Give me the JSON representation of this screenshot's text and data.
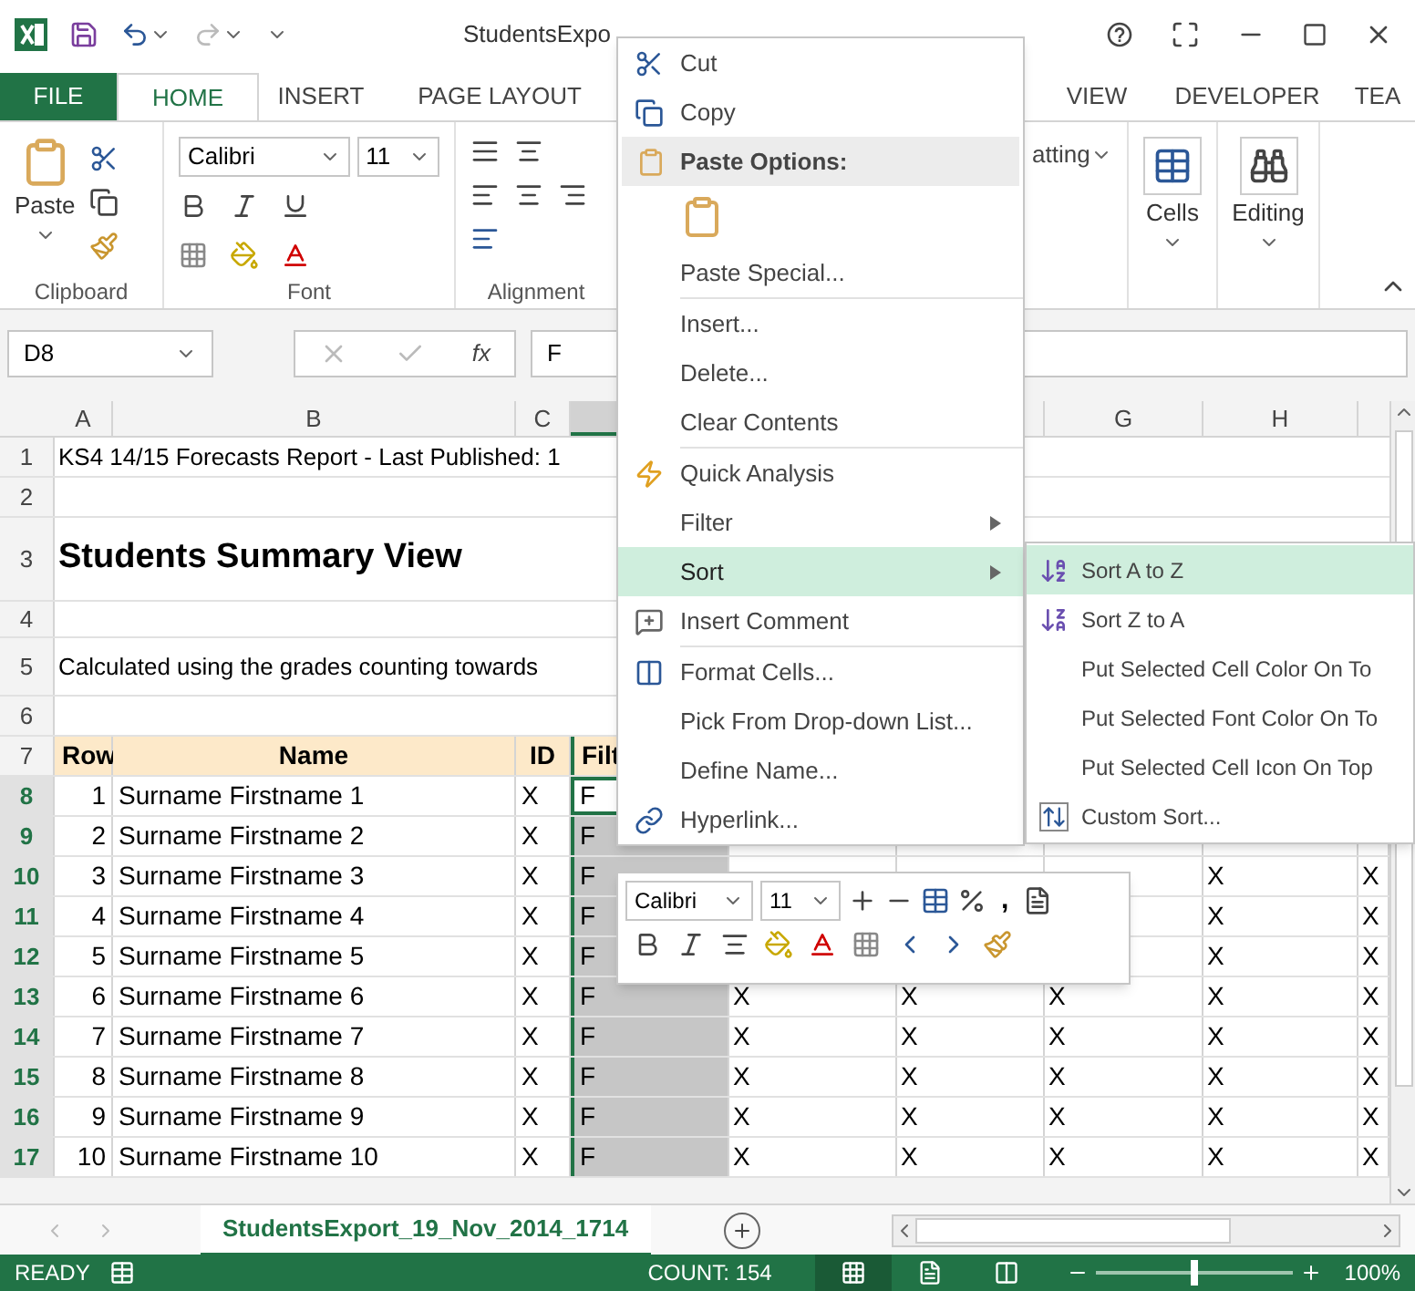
{
  "window": {
    "title": "StudentsExpo"
  },
  "ribbon": {
    "tabs": [
      {
        "label": "FILE",
        "kind": "file",
        "selected": false
      },
      {
        "label": "HOME",
        "kind": "tab",
        "selected": true
      },
      {
        "label": "INSERT",
        "kind": "tab",
        "selected": false
      },
      {
        "label": "PAGE LAYOUT",
        "kind": "tab",
        "selected": false
      },
      {
        "label": "VIEW",
        "kind": "tab",
        "selected": false
      },
      {
        "label": "DEVELOPER",
        "kind": "tab",
        "selected": false
      },
      {
        "label": "TEA",
        "kind": "tab",
        "selected": false
      }
    ],
    "clipboard": {
      "paste": "Paste",
      "label": "Clipboard"
    },
    "font": {
      "name": "Calibri",
      "size": "11",
      "label": "Font"
    },
    "alignment": {
      "label": "Alignment"
    },
    "styles": {
      "label": "atting"
    },
    "cells": {
      "label": "Cells"
    },
    "editing": {
      "label": "Editing"
    }
  },
  "formula_bar": {
    "name_box": "D8",
    "fx": "fx",
    "value": "F"
  },
  "columns_left": [
    {
      "label": "A",
      "selected": false
    },
    {
      "label": "B",
      "selected": false
    },
    {
      "label": "C",
      "selected": false
    }
  ],
  "selected_column": {
    "selected": true
  },
  "columns_right": [
    {
      "label": "G",
      "selected": false
    },
    {
      "label": "H",
      "selected": false
    }
  ],
  "rows": [
    {
      "header": "1",
      "kind": "text",
      "text": "KS4 14/15 Forecasts Report - Last Published: 1",
      "selected": false
    },
    {
      "header": "2",
      "kind": "blank",
      "selected": false
    },
    {
      "header": "3",
      "kind": "heading",
      "text": "Students Summary View",
      "selected": false
    },
    {
      "header": "4",
      "kind": "blank",
      "selected": false
    },
    {
      "header": "5",
      "kind": "text",
      "text": "Calculated using the grades counting towards",
      "selected": false
    },
    {
      "header": "6",
      "kind": "blank",
      "selected": false
    },
    {
      "header": "7",
      "kind": "columns",
      "cells": [
        "Row",
        "Name",
        "ID",
        "Filt"
      ],
      "selected": false
    },
    {
      "header": "8",
      "kind": "data",
      "selected": true,
      "active": true,
      "cells": [
        "1",
        "Surname Firstname 1",
        "X",
        "F"
      ]
    },
    {
      "header": "9",
      "kind": "data",
      "selected": true,
      "active": false,
      "cells": [
        "2",
        "Surname Firstname 2",
        "X",
        "F"
      ]
    },
    {
      "header": "10",
      "kind": "data",
      "selected": true,
      "active": false,
      "cells": [
        "3",
        "Surname Firstname 3",
        "X",
        "F"
      ],
      "marks_right": [
        "X",
        "X"
      ]
    },
    {
      "header": "11",
      "kind": "data",
      "selected": true,
      "active": false,
      "cells": [
        "4",
        "Surname Firstname 4",
        "X",
        "F"
      ],
      "marks_right": [
        "X",
        "X"
      ]
    },
    {
      "header": "12",
      "kind": "data",
      "selected": true,
      "active": false,
      "cells": [
        "5",
        "Surname Firstname 5",
        "X",
        "F"
      ],
      "marks_right": [
        "X",
        "X"
      ]
    },
    {
      "header": "13",
      "kind": "data",
      "selected": true,
      "active": false,
      "cells": [
        "6",
        "Surname Firstname 6",
        "X",
        "F"
      ],
      "marks_left": [
        "X",
        "X",
        "X"
      ],
      "marks_right": [
        "X",
        "X"
      ]
    },
    {
      "header": "14",
      "kind": "data",
      "selected": true,
      "active": false,
      "cells": [
        "7",
        "Surname Firstname 7",
        "X",
        "F"
      ],
      "marks_left": [
        "X",
        "X",
        "X"
      ],
      "marks_right": [
        "X",
        "X"
      ]
    },
    {
      "header": "15",
      "kind": "data",
      "selected": true,
      "active": false,
      "cells": [
        "8",
        "Surname Firstname 8",
        "X",
        "F"
      ],
      "marks_left": [
        "X",
        "X",
        "X"
      ],
      "marks_right": [
        "X",
        "X"
      ]
    },
    {
      "header": "16",
      "kind": "data",
      "selected": true,
      "active": false,
      "cells": [
        "9",
        "Surname Firstname 9",
        "X",
        "F"
      ],
      "marks_left": [
        "X",
        "X",
        "X"
      ],
      "marks_right": [
        "X",
        "X"
      ]
    },
    {
      "header": "17",
      "kind": "data",
      "selected": true,
      "active": false,
      "cells": [
        "10",
        "Surname Firstname 10",
        "X",
        "F"
      ],
      "marks_left": [
        "X",
        "X",
        "X"
      ],
      "marks_right": [
        "X",
        "X"
      ]
    }
  ],
  "context_menu": [
    {
      "label": "Cut",
      "kind": "item",
      "selected": false
    },
    {
      "label": "Copy",
      "kind": "item",
      "selected": false
    },
    {
      "label": "Paste Options:",
      "kind": "header"
    },
    {
      "kind": "paste_option"
    },
    {
      "label": "Paste Special...",
      "kind": "item",
      "selected": false
    },
    {
      "kind": "separator"
    },
    {
      "label": "Insert...",
      "kind": "item",
      "selected": false
    },
    {
      "label": "Delete...",
      "kind": "item",
      "selected": false
    },
    {
      "label": "Clear Contents",
      "kind": "item",
      "selected": false
    },
    {
      "kind": "separator"
    },
    {
      "label": "Quick Analysis",
      "kind": "item",
      "selected": false
    },
    {
      "label": "Filter",
      "kind": "submenu",
      "selected": false
    },
    {
      "label": "Sort",
      "kind": "submenu",
      "selected": true
    },
    {
      "label": "Insert Comment",
      "kind": "item",
      "selected": false
    },
    {
      "kind": "separator"
    },
    {
      "label": "Format Cells...",
      "kind": "item",
      "selected": false
    },
    {
      "label": "Pick From Drop-down List...",
      "kind": "item",
      "selected": false
    },
    {
      "label": "Define Name...",
      "kind": "item",
      "selected": false
    },
    {
      "label": "Hyperlink...",
      "kind": "item",
      "selected": false
    }
  ],
  "sort_submenu": [
    {
      "label": "Sort A to Z",
      "selected": true
    },
    {
      "label": "Sort Z to A",
      "selected": false
    },
    {
      "label": "Put Selected Cell Color On To",
      "selected": false
    },
    {
      "label": "Put Selected Font Color On To",
      "selected": false
    },
    {
      "label": "Put Selected Cell Icon On Top",
      "selected": false
    },
    {
      "label": "Custom Sort...",
      "selected": false
    }
  ],
  "mini_toolbar": {
    "font_name": "Calibri",
    "font_size": "11",
    "comma": ","
  },
  "sheet_tabs": [
    {
      "label": "StudentsExport_19_Nov_2014_1714",
      "selected": true
    }
  ],
  "status_bar": {
    "mode": "READY",
    "count": "COUNT: 154",
    "views": [
      {
        "selected": true
      },
      {
        "selected": false
      },
      {
        "selected": false
      }
    ],
    "zoom_slider": {
      "level": 0.5
    },
    "zoom": "100%"
  }
}
